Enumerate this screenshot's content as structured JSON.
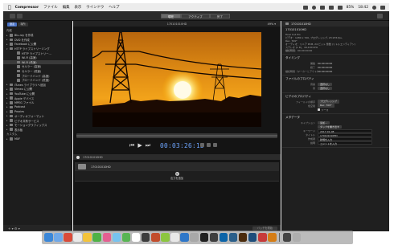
{
  "menubar": {
    "app_name": "Compressor",
    "menus": [
      "ファイル",
      "編集",
      "表示",
      "ウインドウ",
      "ヘルプ"
    ],
    "battery": "85%",
    "clock": "18:42"
  },
  "toolbar": {
    "segments": [
      "現在",
      "アクティブ",
      "完了"
    ],
    "right_label": "ジョブ"
  },
  "sidebar": {
    "tabs": [
      "設定",
      "場所"
    ],
    "heading": "内蔵",
    "items": [
      {
        "label": "Blu-ray を作成",
        "level": 1,
        "tri": "▸"
      },
      {
        "label": "DVD を作成",
        "level": 1,
        "tri": "▸"
      },
      {
        "label": "Facebook に公開",
        "level": 1,
        "tri": "▸"
      },
      {
        "label": "HTTP ライブストリーミング",
        "level": 1,
        "tri": "▾"
      },
      {
        "label": "HTTP ライブストリー…",
        "level": 2,
        "tri": ""
      },
      {
        "label": "Wi-Fi (高速)",
        "level": 2,
        "tri": ""
      },
      {
        "label": "Wi-Fi (低速)",
        "level": 2,
        "tri": "",
        "selected": true
      },
      {
        "label": "セルラー (高速)",
        "level": 2,
        "tri": ""
      },
      {
        "label": "セルラー (低速)",
        "level": 2,
        "tri": ""
      },
      {
        "label": "ブロードバンド (高速)",
        "level": 2,
        "tri": ""
      },
      {
        "label": "ブロードバンド (低速)",
        "level": 2,
        "tri": ""
      },
      {
        "label": "iTunes ライブラリへ追加",
        "level": 1,
        "tri": "▸"
      },
      {
        "label": "Vimeo に公開",
        "level": 1,
        "tri": "▸"
      },
      {
        "label": "YouTube に公開",
        "level": 1,
        "tri": "▸"
      },
      {
        "label": "Apple デバイス",
        "level": 1,
        "tri": "▸"
      },
      {
        "label": "MPEG ファイル",
        "level": 1,
        "tri": "▸"
      },
      {
        "label": "Podcast",
        "level": 1,
        "tri": "▸"
      },
      {
        "label": "Proxies",
        "level": 1,
        "tri": "▸"
      },
      {
        "label": "オーディオフォーマット",
        "level": 1,
        "tri": "▸"
      },
      {
        "label": "ビデオ共有サービス",
        "level": 1,
        "tri": "▸"
      },
      {
        "label": "モーショングラフィックス",
        "level": 1,
        "tri": "▸"
      },
      {
        "label": "表示板",
        "level": 1,
        "tri": "▸"
      }
    ],
    "custom_heading": "カスタム",
    "custom_items": [
      {
        "label": "MXF",
        "level": 1,
        "tri": "▸"
      }
    ],
    "footer": "+ ▾  ⚙ ▾"
  },
  "viewer": {
    "title": "170101010HD",
    "zoom": "49% ▾",
    "timecode": "00:03:26:15"
  },
  "batch": {
    "title": "170101010HD",
    "add_output_label": "出力を追加",
    "start_label": "バッチを開始"
  },
  "inspector": {
    "title": "170101010HD",
    "file_name": "170101010HD",
    "file_kind": "Final Cut Pro",
    "file_info_lines": [
      "ビデオ：1280 x 720, プログレッシブ, 23.976 fps,",
      "Rec. 709*",
      "オーディオ：リニア PCM, 24 ビット 整数 (リトルエンディアン)",
      "ステレオ (L R)、44,100 kHz",
      "継続時間：00:00:00:00"
    ],
    "timing_title": "タイミング",
    "timing": [
      {
        "k": "開始",
        "v": "00:00:00:00"
      },
      {
        "k": "終了",
        "v": "00:00:00:00"
      },
      {
        "k": "継続時間（マーカーとアウト）",
        "v": "00:00:00:00"
      }
    ],
    "file_props_title": "ファイルのプロパティ",
    "file_props": [
      {
        "k": "音楽",
        "v": "選択なし"
      },
      {
        "k": "音",
        "v": "選択なし"
      }
    ],
    "video_props_title": "ビデオのプロパティ",
    "video_props": [
      {
        "k": "フィールドの順序",
        "v": "プログレッシブ"
      },
      {
        "k": "色空間",
        "v": "Rec. 709*"
      }
    ],
    "checkbox_label": "ソース",
    "metadata_title": "メタデータ",
    "metadata": [
      {
        "k": "キャプション",
        "v": "追加..."
      },
      {
        "k": "",
        "v": "ダップを書き出す"
      },
      {
        "k": "キーワード",
        "v": "2017-01-08"
      },
      {
        "k": "タイトル",
        "v": "170101010HD"
      },
      {
        "k": "作成者",
        "v": "新規を入力"
      },
      {
        "k": "説明",
        "v": "コメントを入力"
      }
    ]
  },
  "dock": {
    "colors": [
      "#3b87d8",
      "#6fa8e8",
      "#d94b3a",
      "#e9e9e9",
      "#f3c33a",
      "#4fb246",
      "#e45f91",
      "#76c3ef",
      "#58b553",
      "#ffffff",
      "#3d3d3d",
      "#c24d2c",
      "#8cc63f",
      "#e8e8e8",
      "#2e77c9",
      "#a8a8a8",
      "#202020",
      "#3f3f3f",
      "#0c64a8",
      "#2b5f8a",
      "#4b2b0c",
      "#1e4d7b",
      "#c73a3a",
      "#d57d16",
      "#444444",
      "#aeaeae"
    ]
  }
}
